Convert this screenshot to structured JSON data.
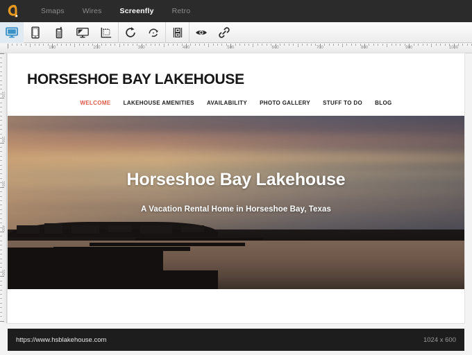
{
  "app": {
    "logo_icon": "aviary-a-logo-icon",
    "tabs": [
      {
        "label": "Smaps",
        "active": false
      },
      {
        "label": "Wires",
        "active": false
      },
      {
        "label": "Screenfly",
        "active": true
      },
      {
        "label": "Retro",
        "active": false
      }
    ]
  },
  "toolbar": {
    "items": [
      {
        "name": "desktop-icon",
        "title": "Desktop",
        "active": true
      },
      {
        "name": "tablet-icon",
        "title": "Tablet",
        "active": false
      },
      {
        "name": "mobile-icon",
        "title": "Mobile",
        "active": false
      },
      {
        "name": "television-icon",
        "title": "Television",
        "active": false
      },
      {
        "name": "custom-size-icon",
        "title": "Custom Size",
        "active": false
      },
      {
        "name": "refresh-icon",
        "title": "Refresh",
        "active": false
      },
      {
        "name": "rotate-icon",
        "title": "Rotate",
        "active": false
      },
      {
        "name": "layout-icon",
        "title": "Layout",
        "active": false
      },
      {
        "name": "preview-eye-icon",
        "title": "Preview",
        "active": false
      },
      {
        "name": "link-icon",
        "title": "Link",
        "active": false
      }
    ]
  },
  "ruler": {
    "labels": [
      100,
      200,
      300,
      400,
      500,
      600,
      700,
      800,
      900,
      1000
    ],
    "unit_step": 100
  },
  "site": {
    "title": "HORSESHOE BAY LAKEHOUSE",
    "nav": [
      {
        "label": "WELCOME",
        "active": true
      },
      {
        "label": "LAKEHOUSE AMENITIES",
        "active": false
      },
      {
        "label": "AVAILABILITY",
        "active": false
      },
      {
        "label": "PHOTO GALLERY",
        "active": false
      },
      {
        "label": "STUFF TO DO",
        "active": false
      },
      {
        "label": "BLOG",
        "active": false
      }
    ],
    "hero": {
      "title": "Horseshoe Bay Lakehouse",
      "subtitle": "A Vacation Rental Home in Horseshoe Bay, Texas",
      "image_alt": "sunset-over-lake-with-docks"
    }
  },
  "status": {
    "url": "https://www.hsblakehouse.com",
    "dimensions": "1024 x 600"
  },
  "colors": {
    "topbar_bg": "#2b2b2b",
    "accent_logo": "#e8991f",
    "tab_active": "#ffffff",
    "tool_active_bg": "#dfeaf2",
    "tool_active_fg": "#3a92c8",
    "nav_active": "#e0584a",
    "statusbar_bg": "#1d1d1d"
  }
}
